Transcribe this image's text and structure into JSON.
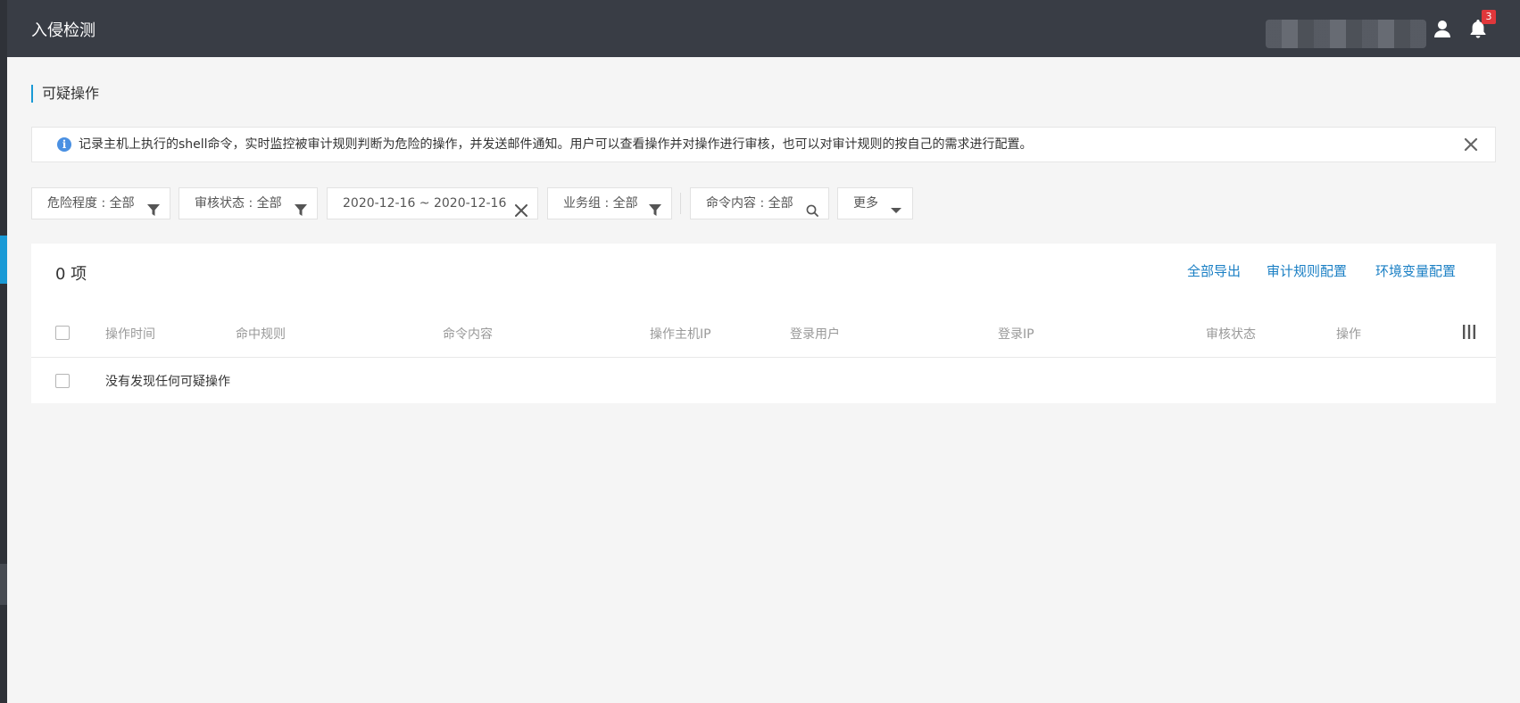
{
  "header": {
    "title": "入侵检测",
    "notification_count": "3",
    "icons": {
      "user": "user-icon",
      "bell": "bell-icon"
    }
  },
  "page": {
    "section_title": "可疑操作",
    "info": "记录主机上执行的shell命令，实时监控被审计规则判断为危险的操作，并发送邮件通知。用户可以查看操作并对操作进行审核，也可以对审计规则的按自己的需求进行配置。"
  },
  "filters": {
    "risk_level": "危险程度 : 全部",
    "review_status": "审核状态 : 全部",
    "date_range": "2020-12-16 ~ 2020-12-16",
    "business_group": "业务组 : 全部",
    "command_content": "命令内容 : 全部",
    "more": "更多"
  },
  "table": {
    "count_label": "0 项",
    "actions": [
      "全部导出",
      "审计规则配置",
      "环境变量配置"
    ],
    "columns": [
      "操作时间",
      "命中规则",
      "命令内容",
      "操作主机IP",
      "登录用户",
      "登录IP",
      "审核状态",
      "操作"
    ],
    "empty_text": "没有发现任何可疑操作"
  },
  "colors": {
    "topbar": "#393d45",
    "accent": "#1a9ad6",
    "link": "#1a7fc4",
    "badge": "#e0373b",
    "info_icon": "#4a90e2"
  }
}
